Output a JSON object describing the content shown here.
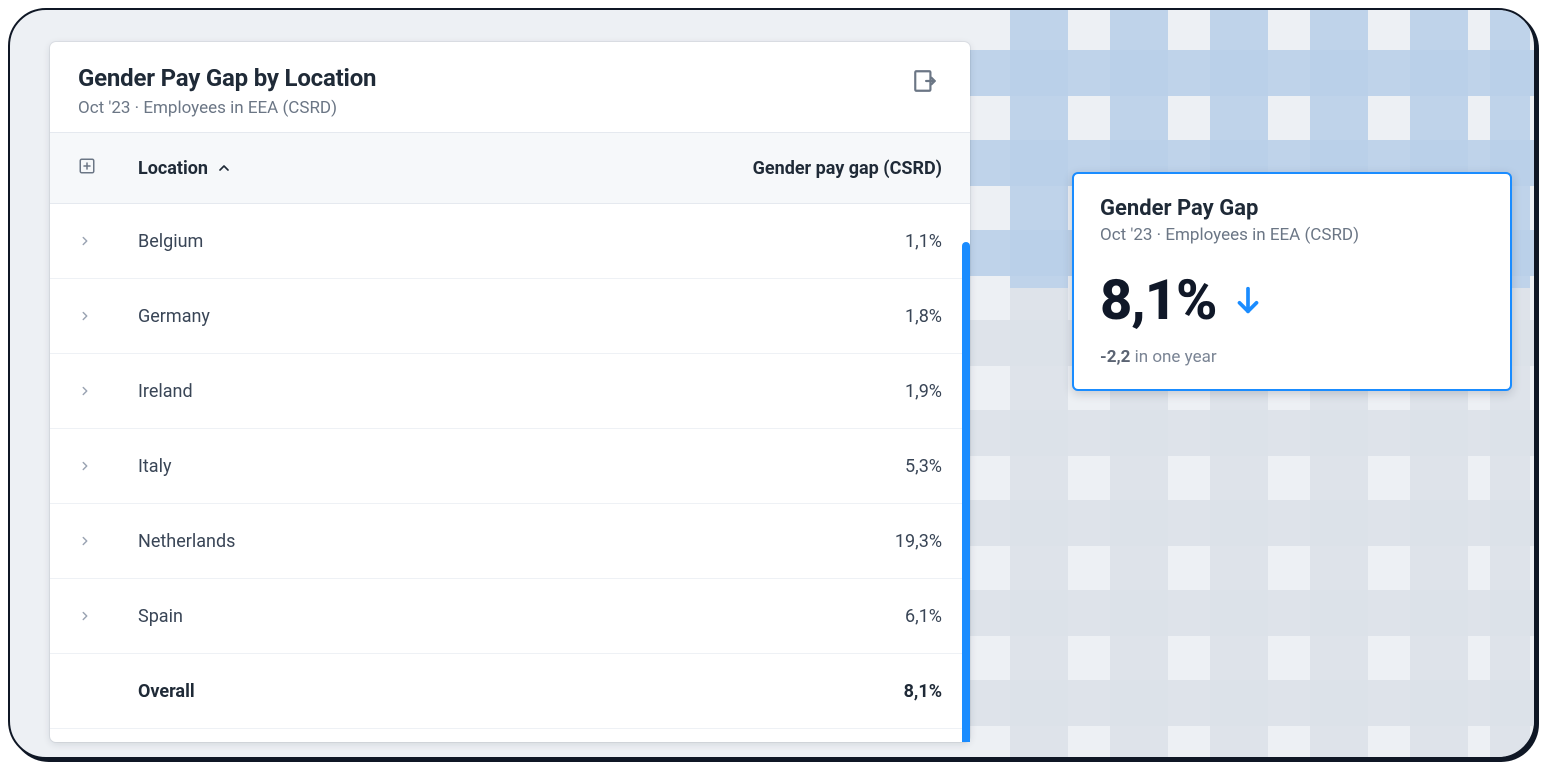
{
  "card": {
    "title": "Gender Pay Gap by Location",
    "subtitle": "Oct '23 · Employees in EEA (CSRD)",
    "columns": {
      "location": "Location",
      "value": "Gender pay gap (CSRD)"
    },
    "rows": [
      {
        "location": "Belgium",
        "value": "1,1%"
      },
      {
        "location": "Germany",
        "value": "1,8%"
      },
      {
        "location": "Ireland",
        "value": "1,9%"
      },
      {
        "location": "Italy",
        "value": "5,3%"
      },
      {
        "location": "Netherlands",
        "value": "19,3%"
      },
      {
        "location": "Spain",
        "value": "6,1%"
      }
    ],
    "overall": {
      "label": "Overall",
      "value": "8,1%"
    }
  },
  "kpi": {
    "title": "Gender Pay Gap",
    "subtitle": "Oct '23 · Employees in EEA (CSRD)",
    "value": "8,1%",
    "delta": "-2,2",
    "delta_text": "in one year"
  },
  "chart_data": {
    "type": "table",
    "title": "Gender Pay Gap by Location",
    "xlabel": "Location",
    "ylabel": "Gender pay gap (CSRD) %",
    "categories": [
      "Belgium",
      "Germany",
      "Ireland",
      "Italy",
      "Netherlands",
      "Spain",
      "Overall"
    ],
    "values": [
      1.1,
      1.8,
      1.9,
      5.3,
      19.3,
      6.1,
      8.1
    ]
  }
}
